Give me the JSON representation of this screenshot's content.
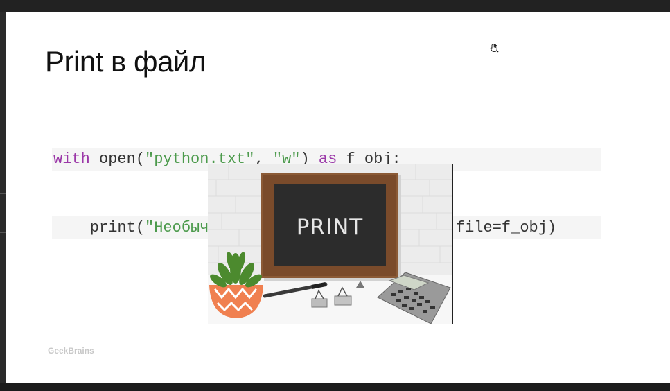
{
  "slide": {
    "title": "Print в файл",
    "brand": "GeekBrains"
  },
  "code": {
    "line1": {
      "kw_with": "with",
      "open_call": " open(",
      "arg_file": "\"python.txt\"",
      "sep": ", ",
      "arg_mode": "\"w\"",
      "close": ") ",
      "kw_as": "as",
      "tail": " f_obj:"
    },
    "line2": {
      "indent_print": "    print(",
      "arg_text": "\"Необычная работа функции print\"",
      "tail": ", file=f_obj)"
    }
  },
  "image": {
    "board_text": "PRINT"
  },
  "icons": {
    "cursor": "hand-cursor-icon"
  },
  "colors": {
    "keyword": "#9b38a8",
    "string": "#4c9a4c",
    "board": "#2c2c2c",
    "frame": "#8b5a36"
  }
}
